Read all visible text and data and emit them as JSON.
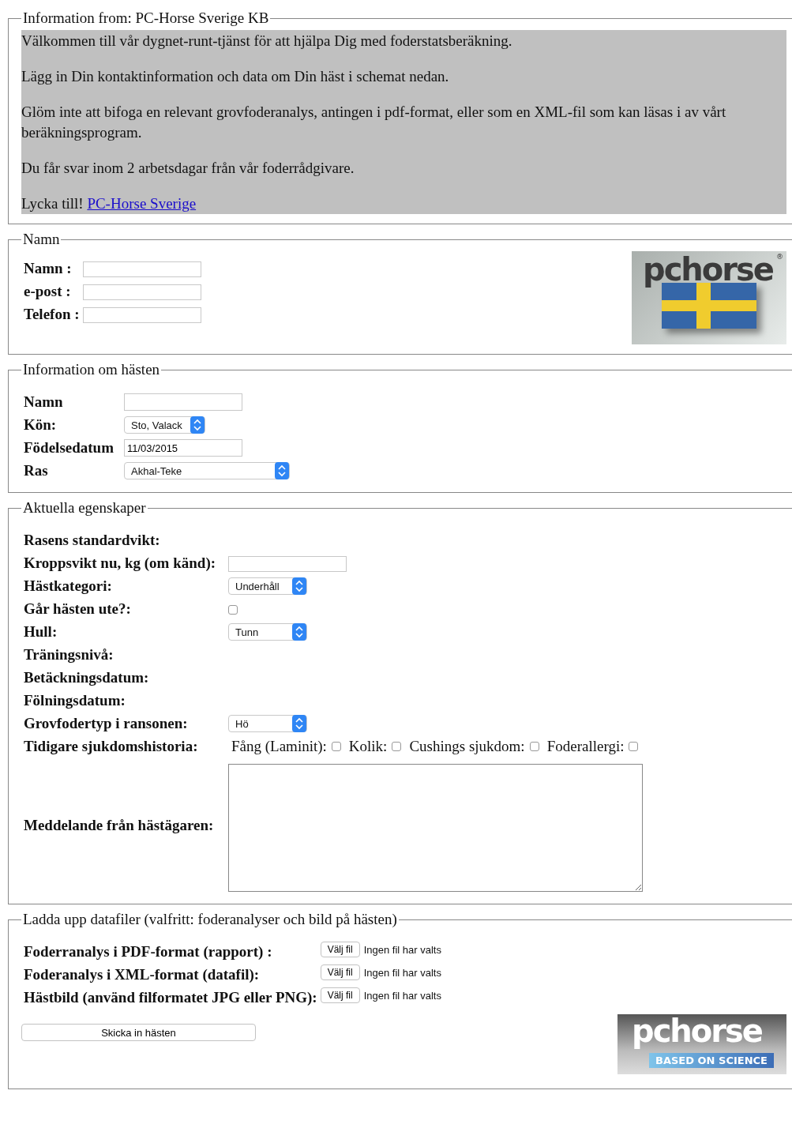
{
  "info": {
    "legend": "Information from: PC-Horse Sverige KB",
    "paragraphs": [
      "Välkommen till vår dygnet-runt-tjänst för att hjälpa Dig med foderstatsberäkning.",
      "Lägg in Din kontaktinformation och data om Din häst i schemat nedan.",
      "Glöm inte att bifoga en relevant grovfoderanalys, antingen i pdf-format, eller som en XML-fil som kan läsas i av vårt beräkningsprogram.",
      "Du får svar inom 2 arbetsdagar från vår foderrådgivare."
    ],
    "closing": {
      "text": "Lycka till!",
      "link": "PC-Horse Sverige"
    }
  },
  "contact": {
    "legend": "Namn",
    "fields": [
      {
        "label": "Namn :"
      },
      {
        "label": "e-post :"
      },
      {
        "label": "Telefon :"
      }
    ],
    "logo": {
      "text": "pchorse",
      "mark": "®"
    }
  },
  "horse": {
    "legend": "Information om hästen",
    "rows": [
      {
        "label": "Namn",
        "kind": "text"
      },
      {
        "label": "Kön:",
        "kind": "select",
        "value": "Sto, Valack"
      },
      {
        "label": "Födelsedatum",
        "kind": "text",
        "value": "11/03/2015"
      },
      {
        "label": "Ras",
        "kind": "select",
        "value": "Akhal-Teke"
      }
    ]
  },
  "properties": {
    "legend": "Aktuella egenskaper",
    "rows": [
      {
        "label": "Rasens standardvikt:",
        "kind": "none"
      },
      {
        "label": "Kroppsvikt nu, kg (om känd):",
        "kind": "text"
      },
      {
        "label": "Hästkategori:",
        "kind": "select",
        "value": "Underhåll"
      },
      {
        "label": "Går hästen ute?:",
        "kind": "checkbox",
        "checked": false
      },
      {
        "label": "Hull:",
        "kind": "select",
        "value": "Tunn"
      },
      {
        "label": "Träningsnivå:",
        "kind": "none"
      },
      {
        "label": "Betäckningsdatum:",
        "kind": "none"
      },
      {
        "label": "Fölningsdatum:",
        "kind": "none"
      },
      {
        "label": "Grovfodertyp i ransonen:",
        "kind": "select",
        "value": "Hö"
      },
      {
        "label": "Tidigare sjukdomshistoria:",
        "kind": "checks",
        "options": [
          {
            "label": "Fång (Laminit):",
            "checked": false
          },
          {
            "label": "Kolik:",
            "checked": false
          },
          {
            "label": "Cushings sjukdom:",
            "checked": false
          },
          {
            "label": "Foderallergi:",
            "checked": false
          }
        ]
      },
      {
        "label": "Meddelande från hästägaren:",
        "kind": "textarea"
      }
    ]
  },
  "uploads": {
    "legend": "Ladda upp datafiler (valfritt: foderanalyser och bild på hästen)",
    "files": [
      {
        "label": "Foderranalys i PDF-format (rapport) :",
        "button": "Välj fil",
        "status": "Ingen fil har valts"
      },
      {
        "label": "Foderanalys i XML-format (datafil):",
        "button": "Välj fil",
        "status": "Ingen fil har valts"
      },
      {
        "label": "Hästbild (använd filformatet JPG eller PNG):",
        "button": "Välj fil",
        "status": "Ingen fil har valts"
      }
    ],
    "submit": "Skicka in hästen",
    "logo": {
      "text": "pchorse",
      "tagline": "BASED ON SCIENCE"
    }
  }
}
